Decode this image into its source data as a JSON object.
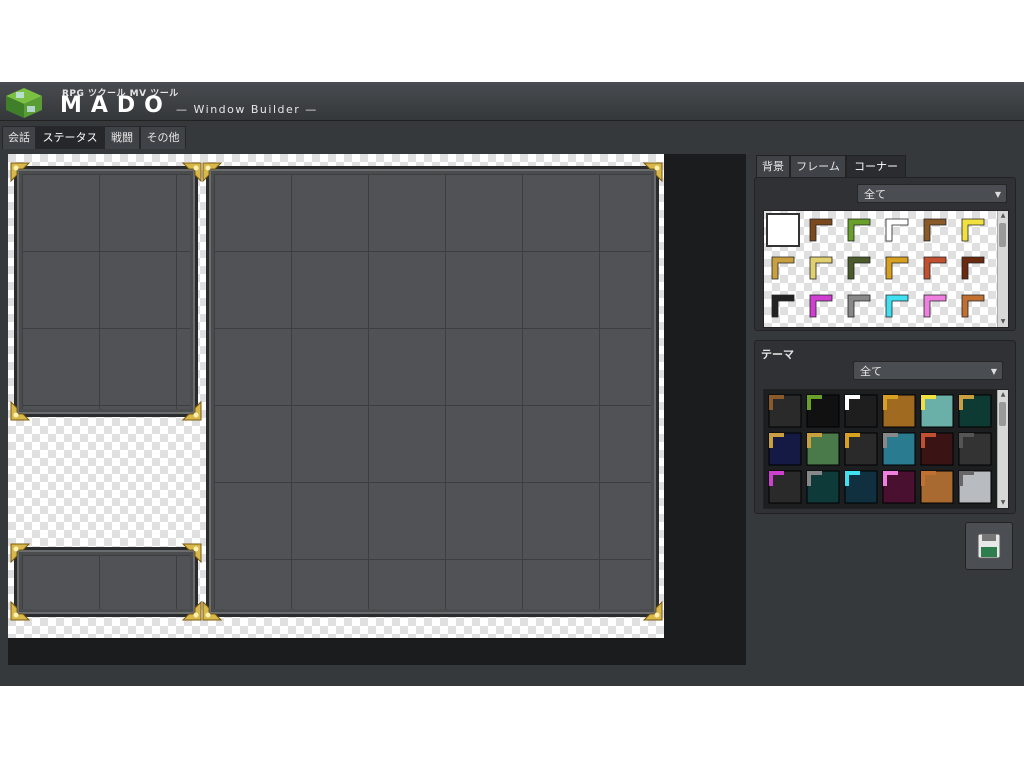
{
  "app": {
    "subtitle": "RPG ツクール MV ツール",
    "name": "MADO",
    "tagline": "— Window Builder —"
  },
  "tabs": [
    {
      "label": "会話",
      "active": false
    },
    {
      "label": "ステータス",
      "active": true
    },
    {
      "label": "戦闘",
      "active": false
    },
    {
      "label": "その他",
      "active": false
    }
  ],
  "parts_panel": {
    "tabs": [
      {
        "label": "背景",
        "active": false
      },
      {
        "label": "フレーム",
        "active": false
      },
      {
        "label": "コーナー",
        "active": true
      }
    ],
    "filter": "全て",
    "items": [
      "corner-none",
      "corner-wood",
      "corner-vine",
      "corner-white",
      "corner-brown-small",
      "corner-star",
      "corner-gold-swirl",
      "corner-yellow-small",
      "corner-olive",
      "corner-gold",
      "corner-red-small",
      "corner-dark-brown",
      "corner-black",
      "corner-magenta",
      "corner-gray",
      "corner-cyan",
      "corner-pink-swirl",
      "corner-copper"
    ]
  },
  "theme_panel": {
    "title": "テーマ",
    "filter": "全て",
    "items": [
      "theme-wood-dark",
      "theme-vine-black",
      "theme-white-dark",
      "theme-gold-wood",
      "theme-teal-star",
      "theme-green-dark",
      "theme-navy-gold",
      "theme-green-leaf",
      "theme-gold-diamond",
      "theme-teal-blue",
      "theme-maroon",
      "theme-charcoal",
      "theme-purple-dots",
      "theme-teal-dark",
      "theme-cyan-frame",
      "theme-pink-stripe",
      "theme-wood-plank",
      "theme-light-stone"
    ]
  },
  "colors": {
    "accent_gold": "#d8b84a",
    "window_fill": "#505255",
    "canvas_bg": "#1b1c1d"
  },
  "toolbar": {
    "save_icon": "floppy-disk-icon"
  }
}
